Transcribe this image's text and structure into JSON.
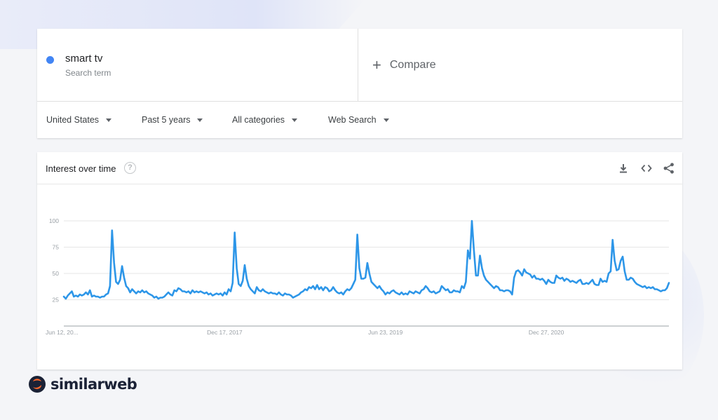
{
  "search_term": {
    "name": "smart tv",
    "subtitle": "Search term",
    "color": "#4285f4"
  },
  "compare": {
    "label": "Compare"
  },
  "filters": [
    {
      "label": "United States"
    },
    {
      "label": "Past 5 years"
    },
    {
      "label": "All categories"
    },
    {
      "label": "Web Search"
    }
  ],
  "chart_header": {
    "title": "Interest over time",
    "help_icon": "help-circle-icon",
    "actions": [
      "download-icon",
      "embed-code-icon",
      "share-icon"
    ]
  },
  "brand": {
    "name": "similarweb"
  },
  "chart_data": {
    "type": "line",
    "title": "Interest over time",
    "series": [
      {
        "name": "smart tv",
        "color": "#2d96e8",
        "values": [
          28,
          26,
          29,
          31,
          33,
          28,
          29,
          28,
          30,
          29,
          30,
          32,
          30,
          34,
          28,
          29,
          28,
          28,
          27,
          28,
          28,
          30,
          31,
          38,
          91,
          60,
          42,
          40,
          44,
          57,
          46,
          38,
          36,
          32,
          35,
          33,
          31,
          33,
          32,
          34,
          32,
          33,
          31,
          30,
          29,
          27,
          28,
          26,
          27,
          27,
          28,
          30,
          32,
          30,
          29,
          34,
          33,
          36,
          35,
          33,
          33,
          32,
          33,
          31,
          34,
          32,
          33,
          32,
          33,
          32,
          31,
          32,
          30,
          31,
          29,
          30,
          31,
          30,
          31,
          29,
          32,
          30,
          35,
          33,
          41,
          89,
          55,
          40,
          38,
          43,
          58,
          45,
          38,
          35,
          33,
          31,
          37,
          34,
          33,
          35,
          33,
          32,
          31,
          32,
          31,
          31,
          30,
          32,
          30,
          29,
          31,
          30,
          30,
          29,
          27,
          28,
          29,
          30,
          32,
          33,
          35,
          34,
          37,
          36,
          38,
          35,
          39,
          35,
          37,
          34,
          37,
          36,
          33,
          34,
          37,
          34,
          32,
          31,
          32,
          30,
          33,
          35,
          34,
          36,
          40,
          44,
          87,
          55,
          45,
          45,
          46,
          60,
          50,
          42,
          40,
          38,
          36,
          38,
          35,
          33,
          30,
          32,
          31,
          33,
          34,
          32,
          31,
          30,
          32,
          30,
          31,
          30,
          33,
          32,
          31,
          33,
          32,
          31,
          34,
          35,
          38,
          36,
          33,
          32,
          33,
          31,
          32,
          33,
          38,
          36,
          34,
          35,
          32,
          32,
          34,
          33,
          33,
          32,
          38,
          36,
          42,
          72,
          64,
          100,
          72,
          48,
          48,
          67,
          55,
          48,
          44,
          42,
          40,
          38,
          36,
          38,
          37,
          34,
          34,
          33,
          34,
          34,
          33,
          30,
          46,
          52,
          53,
          51,
          48,
          54,
          51,
          50,
          49,
          46,
          48,
          45,
          45,
          44,
          45,
          43,
          40,
          44,
          42,
          41,
          41,
          48,
          46,
          45,
          46,
          43,
          45,
          44,
          42,
          43,
          42,
          41,
          43,
          44,
          40,
          40,
          41,
          40,
          42,
          44,
          40,
          39,
          39,
          45,
          42,
          43,
          42,
          50,
          52,
          82,
          62,
          53,
          54,
          62,
          66,
          52,
          44,
          44,
          46,
          45,
          42,
          40,
          39,
          38,
          37,
          38,
          36,
          37,
          36,
          37,
          35,
          35,
          34,
          33,
          34,
          34,
          36,
          41
        ]
      }
    ],
    "x_tick_labels": [
      "Jun 12, 20...",
      "Dec 17, 2017",
      "Jun 23, 2019",
      "Dec 27, 2020"
    ],
    "x_tick_positions": [
      0,
      80,
      160,
      240
    ],
    "y_ticks": [
      25,
      50,
      75,
      100
    ],
    "ylim": [
      0,
      100
    ],
    "grid": true,
    "legend": "none"
  }
}
